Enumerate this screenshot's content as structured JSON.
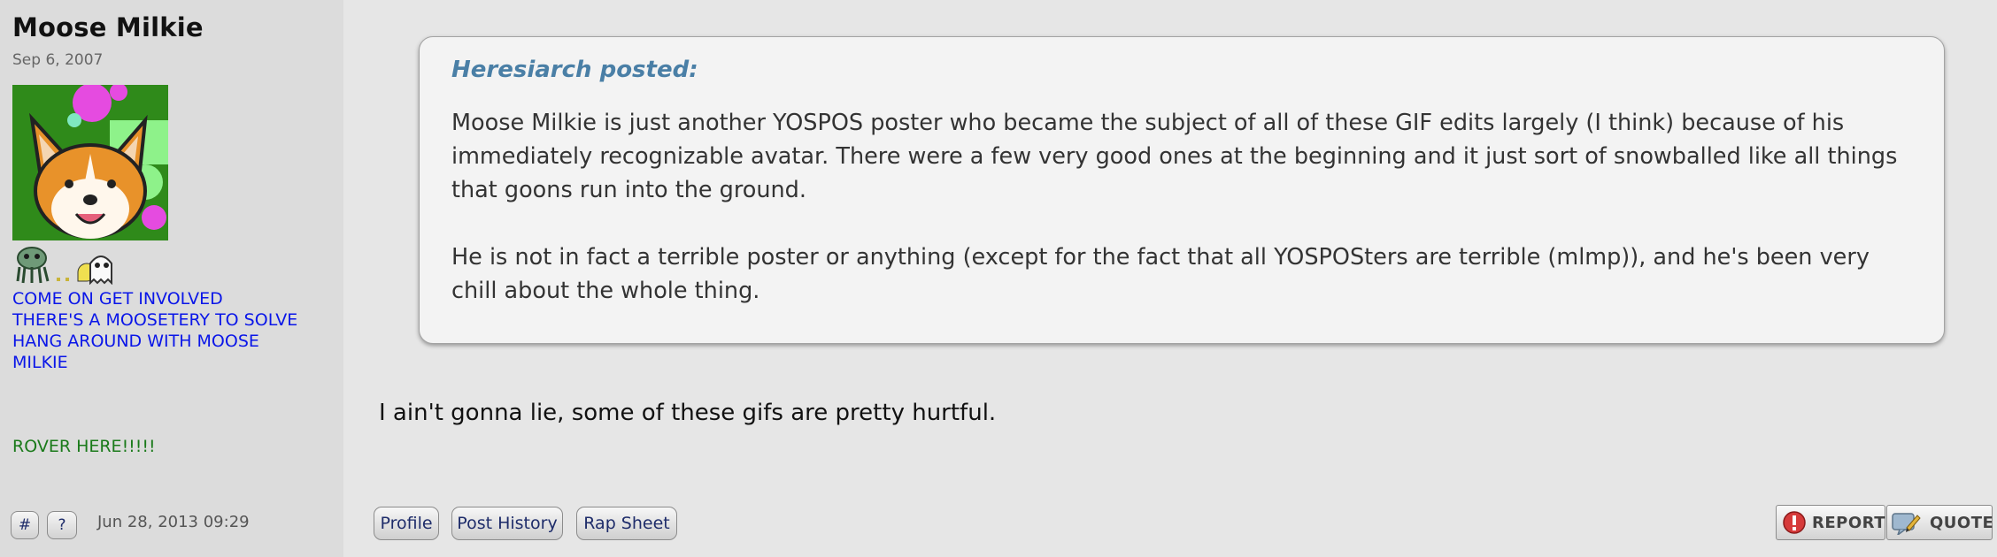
{
  "user": {
    "name": "Moose Milkie",
    "reg_date": "Sep 6, 2007",
    "avatar": "corgi-avatar",
    "title_lines": [
      "COME ON GET INVOLVED",
      "THERE'S A MOOSETERY TO SOLVE",
      "HANG AROUND WITH MOOSE",
      "MILKIE"
    ],
    "title_extra": "ROVER HERE!!!!!"
  },
  "quote": {
    "author": "Heresiarch posted:",
    "paragraphs": [
      "Moose Milkie is just another YOSPOS poster who became the subject of all of these GIF edits largely (I think) because of his immediately recognizable avatar. There were a few very good ones at the beginning and it just sort of snowballed like all things that goons run into the ground.",
      "He is not in fact a terrible poster or anything (except for the fact that all YOSPOSters are terrible (mlmp)), and he's been very chill about the whole thing."
    ]
  },
  "post": {
    "body": "I ain't gonna lie, some of these gifs are pretty hurtful.",
    "date": "Jun 28, 2013 09:29"
  },
  "controls": {
    "hash": "#",
    "question": "?",
    "profile": "Profile",
    "post_history": "Post History",
    "rap_sheet": "Rap Sheet",
    "report": "REPORT",
    "quote": "QUOTE"
  },
  "colors": {
    "title_blue": "#0a16e8",
    "title_green": "#1a7a1a",
    "quote_author": "#4a7fa6",
    "report_icon": "#d63a3a"
  }
}
